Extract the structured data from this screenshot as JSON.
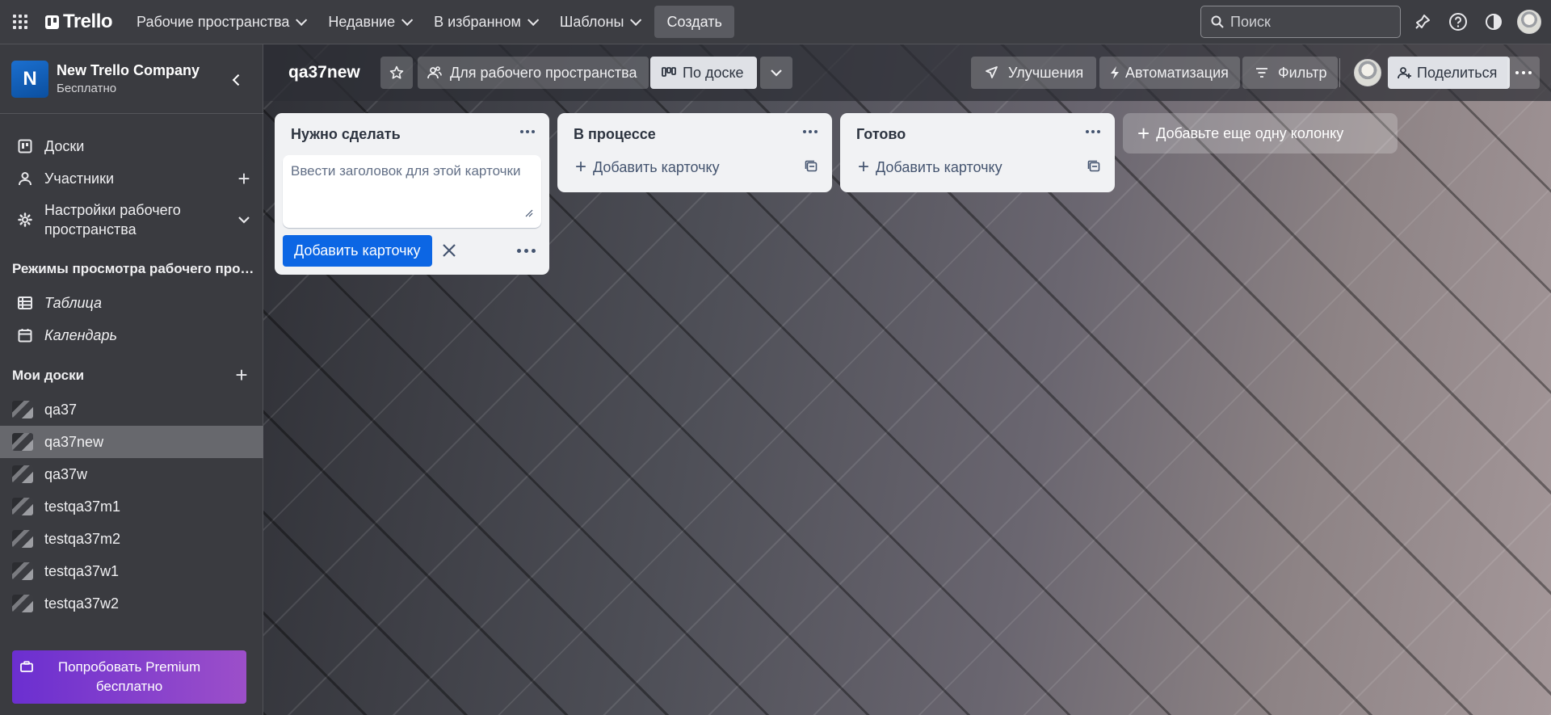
{
  "topnav": {
    "logo": "Trello",
    "menus": [
      "Рабочие пространства",
      "Недавние",
      "В избранном",
      "Шаблоны"
    ],
    "create": "Создать",
    "search_placeholder": "Поиск"
  },
  "sidebar": {
    "workspace_initial": "N",
    "workspace_name": "New Trello Company",
    "workspace_plan": "Бесплатно",
    "nav": {
      "boards": "Доски",
      "members": "Участники",
      "settings_line1": "Настройки рабочего",
      "settings_line2": "пространства"
    },
    "views_title": "Режимы просмотра рабочего пространства",
    "views": {
      "table": "Таблица",
      "calendar": "Календарь"
    },
    "my_boards_title": "Мои доски",
    "boards": [
      "qa37",
      "qa37new",
      "qa37w",
      "testqa37m1",
      "testqa37m2",
      "testqa37w1",
      "testqa37w2"
    ],
    "active_board": "qa37new",
    "premium_line1": "Попробовать Premium",
    "premium_line2": "бесплатно"
  },
  "board": {
    "title": "qa37new",
    "visibility": "Для рабочего пространства",
    "view": "По доске",
    "powerups": "Улучшения",
    "automation": "Автоматизация",
    "filter": "Фильтр",
    "share": "Поделиться"
  },
  "lists": [
    {
      "title": "Нужно сделать",
      "composer_placeholder": "Ввести заголовок для этой карточки",
      "add_button": "Добавить карточку"
    },
    {
      "title": "В процессе",
      "add_card": "Добавить карточку"
    },
    {
      "title": "Готово",
      "add_card": "Добавить карточку"
    }
  ],
  "add_list": "Добавьте еще одну колонку"
}
